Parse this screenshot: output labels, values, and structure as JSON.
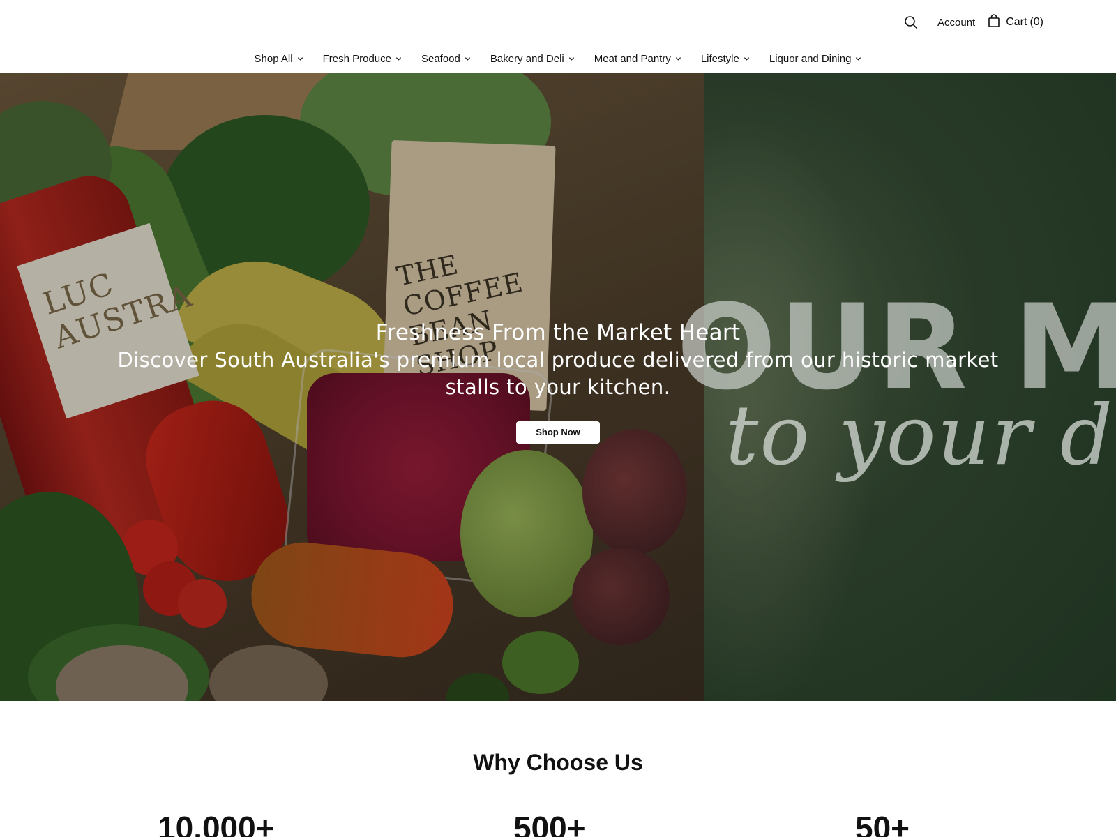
{
  "header": {
    "search_icon": "search-icon",
    "account_label": "Account",
    "cart_icon": "shopping-bag-icon",
    "cart_label": "Cart",
    "cart_count": "(0)"
  },
  "nav": {
    "items": [
      {
        "label": "Shop All"
      },
      {
        "label": "Fresh Produce"
      },
      {
        "label": "Seafood"
      },
      {
        "label": "Bakery and Deli"
      },
      {
        "label": "Meat and Pantry"
      },
      {
        "label": "Lifestyle"
      },
      {
        "label": "Liquor and Dining"
      }
    ]
  },
  "hero": {
    "title": "Freshness From the Market Heart",
    "subtitle": "Discover South Australia's premium local produce delivered from our historic market stalls to your kitchen.",
    "cta_label": "Shop Now",
    "bg_text_main": "OUR MAR",
    "bg_text_script": "to your d",
    "bag_text": "THE COFFEE BEAN SHOP",
    "bottle_text": "LUC AUSTRA"
  },
  "why": {
    "title": "Why Choose Us",
    "stats": [
      "10,000+",
      "500+",
      "50+"
    ]
  },
  "colors": {
    "accent_green": "#2d4a2c",
    "text": "#111111",
    "white": "#ffffff"
  }
}
